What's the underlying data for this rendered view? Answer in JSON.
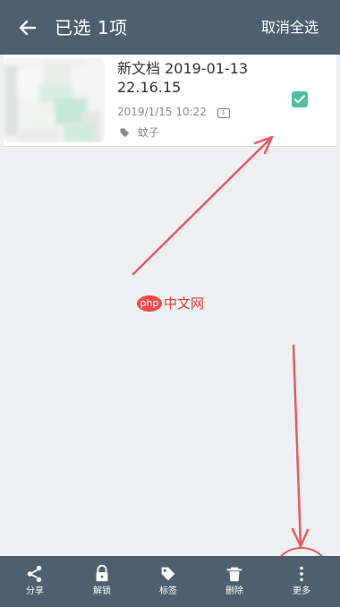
{
  "header": {
    "title": "已选 1项",
    "action_label": "取消全选"
  },
  "note": {
    "title": "新文档 2019-01-13 22.16.15",
    "date": "2019/1/15 10:22",
    "page_count": "1",
    "tag": "蚊子",
    "checked": true
  },
  "watermark": {
    "logo_text": "php",
    "site_text": "中文网"
  },
  "toolbar": {
    "items": [
      {
        "label": "分享",
        "icon": "share-icon"
      },
      {
        "label": "解锁",
        "icon": "unlock-icon"
      },
      {
        "label": "标签",
        "icon": "tag-icon"
      },
      {
        "label": "删除",
        "icon": "trash-icon"
      },
      {
        "label": "更多",
        "icon": "more-vertical-icon"
      }
    ]
  },
  "colors": {
    "bar": "#4f5f6f",
    "background": "#eeeff0",
    "check": "#4fbf9f",
    "annotation": "#e85a62"
  }
}
